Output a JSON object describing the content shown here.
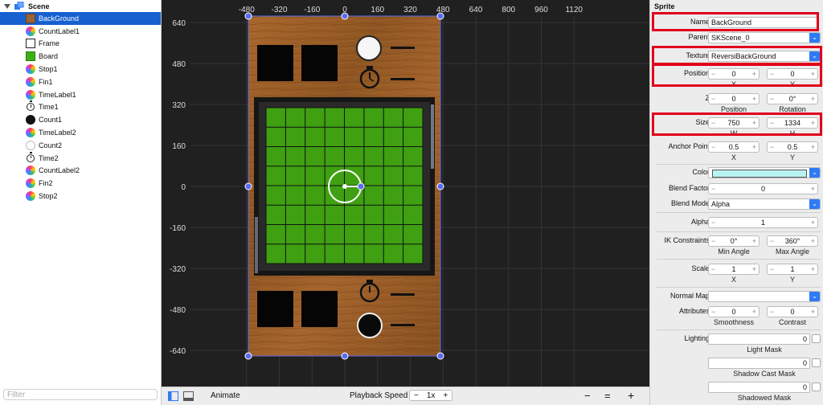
{
  "outline": {
    "root_label": "Scene",
    "items": [
      {
        "label": "BackGround",
        "icon": "background-sprite-icon",
        "selected": true
      },
      {
        "label": "CountLabel1",
        "icon": "label-icon"
      },
      {
        "label": "Frame",
        "icon": "frame-sprite-icon"
      },
      {
        "label": "Board",
        "icon": "board-sprite-icon"
      },
      {
        "label": "Stop1",
        "icon": "label-icon"
      },
      {
        "label": "Fin1",
        "icon": "label-icon"
      },
      {
        "label": "TimeLabel1",
        "icon": "label-icon"
      },
      {
        "label": "Time1",
        "icon": "timer-icon"
      },
      {
        "label": "Count1",
        "icon": "black-disc-icon"
      },
      {
        "label": "TimeLabel2",
        "icon": "label-icon"
      },
      {
        "label": "Count2",
        "icon": "white-disc-icon"
      },
      {
        "label": "Time2",
        "icon": "timer-icon"
      },
      {
        "label": "CountLabel2",
        "icon": "label-icon"
      },
      {
        "label": "Fin2",
        "icon": "label-icon"
      },
      {
        "label": "Stop2",
        "icon": "label-icon"
      }
    ],
    "filter_placeholder": "Filter"
  },
  "canvas": {
    "x_ticks": [
      "-480",
      "-320",
      "-160",
      "0",
      "160",
      "320",
      "480",
      "640",
      "800",
      "960",
      "1120"
    ],
    "y_ticks": [
      "640",
      "480",
      "320",
      "160",
      "0",
      "-160",
      "-320",
      "-480",
      "-640"
    ],
    "board_grid_cells": 8,
    "colors": {
      "wood": "#9b5f2a",
      "board": "#3fa012",
      "frame": "#1a1a1a",
      "selection": "#5b6bf0",
      "canvas_bg": "#202020"
    }
  },
  "toolbar": {
    "animate_label": "Animate",
    "playback_label": "Playback Speed",
    "playback_value": "1x",
    "minus": "−",
    "plus": "+",
    "zoom_out": "−",
    "zoom_reset": "=",
    "zoom_in": "+"
  },
  "inspector": {
    "section_title": "Sprite",
    "name": {
      "label": "Name",
      "value": "BackGround"
    },
    "parent": {
      "label": "Parent",
      "value": "SKScene_0"
    },
    "texture": {
      "label": "Texture",
      "value": "ReversiBackGround"
    },
    "position": {
      "label": "Position",
      "x": "0",
      "y": "0",
      "x_caption": "X",
      "y_caption": "Y"
    },
    "z": {
      "label": "Z",
      "value": "0",
      "rotation": "0°",
      "value_caption": "Position",
      "rotation_caption": "Rotation"
    },
    "size": {
      "label": "Size",
      "w": "750",
      "h": "1334",
      "w_caption": "W",
      "h_caption": "H"
    },
    "anchor": {
      "label": "Anchor Point",
      "x": "0.5",
      "y": "0.5",
      "x_caption": "X",
      "y_caption": "Y"
    },
    "color": {
      "label": "Color",
      "swatch": "#b8f3f0"
    },
    "blend_factor": {
      "label": "Blend Factor",
      "value": "0"
    },
    "blend_mode": {
      "label": "Blend Mode",
      "value": "Alpha"
    },
    "alpha": {
      "label": "Alpha",
      "value": "1"
    },
    "ik": {
      "label": "IK Constraints",
      "min": "0°",
      "max": "360°",
      "min_caption": "Min Angle",
      "max_caption": "Max Angle"
    },
    "scale": {
      "label": "Scale",
      "x": "1",
      "y": "1",
      "x_caption": "X",
      "y_caption": "Y"
    },
    "normal_map": {
      "label": "Normal Map",
      "value": ""
    },
    "attributes": {
      "label": "Attributes",
      "smoothness": "0",
      "contrast": "0",
      "smoothness_caption": "Smoothness",
      "contrast_caption": "Contrast"
    },
    "lighting": {
      "label": "Lighting",
      "light_mask": "0",
      "light_mask_caption": "Light Mask",
      "shadow_cast_mask": "0",
      "shadow_cast_caption": "Shadow Cast Mask",
      "shadowed_mask": "0",
      "shadowed_caption": "Shadowed Mask"
    },
    "minus": "−",
    "plus": "+",
    "popup_arrow": "⌄"
  }
}
